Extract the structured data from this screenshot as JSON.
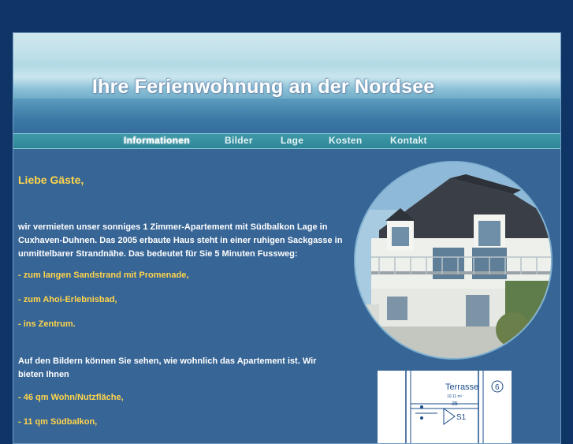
{
  "banner": {
    "title": "Ihre Ferienwohnung an der Nordsee"
  },
  "nav": {
    "items": [
      {
        "label": "Informationen",
        "active": true
      },
      {
        "label": "Bilder"
      },
      {
        "label": "Lage"
      },
      {
        "label": "Kosten"
      },
      {
        "label": "Kontakt"
      }
    ]
  },
  "main": {
    "greeting": "Liebe Gäste,",
    "intro": "wir vermieten unser sonniges 1 Zimmer-Apartement mit Südbalkon Lage in Cuxhaven-Duhnen. Das 2005 erbaute Haus steht in einer ruhigen Sackgasse in unmittelbarer Strandnähe. Das bedeutet für Sie 5 Minuten Fussweg:",
    "distances": [
      "- zum langen Sandstrand mit Promenade,",
      "- zum Ahoi-Erlebnisbad,",
      "- ins Zentrum."
    ],
    "offer_intro": "Auf den Bildern können Sie sehen, wie wohnlich das Apartement ist. Wir bieten Ihnen",
    "features": [
      "- 46 qm Wohn/Nutzfläche,",
      "- 11 qm Südbalkon,"
    ]
  },
  "plan": {
    "label": "Terrasse",
    "number": "6",
    "dim_small": "10.11 m²",
    "dim_value": "35",
    "room": "S1"
  },
  "colors": {
    "page_bg": "#0e3566",
    "content_bg": "#376596",
    "accent_yellow": "#ffd54a",
    "nav_bg": "#2e8797"
  }
}
